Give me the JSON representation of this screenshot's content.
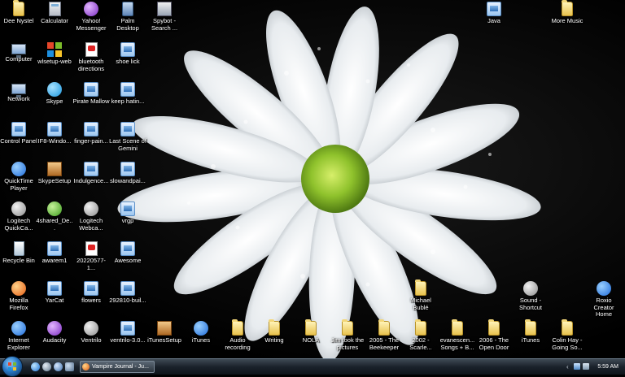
{
  "desktop": {
    "icons": [
      {
        "label": "Dee Nystel",
        "icon": "folder-icon"
      },
      {
        "label": "Calculator",
        "icon": "calculator-icon"
      },
      {
        "label": "Yahoo! Messenger",
        "icon": "yahoo-messenger-icon"
      },
      {
        "label": "Palm Desktop",
        "icon": "palm-desktop-icon"
      },
      {
        "label": "Spybot - Search ...",
        "icon": "spybot-icon"
      },
      {
        "label": "Java",
        "icon": "image-file-icon"
      },
      {
        "label": "More Music",
        "icon": "folder-icon"
      },
      {
        "label": "Computer",
        "icon": "computer-icon"
      },
      {
        "label": "wlsetup-web",
        "icon": "windows-live-icon"
      },
      {
        "label": "bluetooth directions",
        "icon": "pdf-icon"
      },
      {
        "label": "shoe lick",
        "icon": "image-file-icon"
      },
      {
        "label": "Network",
        "icon": "network-icon"
      },
      {
        "label": "Skype",
        "icon": "skype-icon"
      },
      {
        "label": "Pirate Mallow",
        "icon": "image-file-icon"
      },
      {
        "label": "keep hatin...",
        "icon": "image-file-icon"
      },
      {
        "label": "Control Panel",
        "icon": "control-panel-icon"
      },
      {
        "label": "IF8-Windo...",
        "icon": "image-file-icon"
      },
      {
        "label": "finger-pain...",
        "icon": "image-file-icon"
      },
      {
        "label": "Last Scene of Gemini",
        "icon": "image-file-icon"
      },
      {
        "label": "QuickTime Player",
        "icon": "quicktime-icon"
      },
      {
        "label": "SkypeSetup",
        "icon": "skype-setup-icon"
      },
      {
        "label": "Indulgence...",
        "icon": "image-file-icon"
      },
      {
        "label": "slowandpai...",
        "icon": "image-file-icon"
      },
      {
        "label": "Logitech QuickCa...",
        "icon": "logitech-icon"
      },
      {
        "label": "4shared_De...",
        "icon": "shared-desktop-icon"
      },
      {
        "label": "Logitech Webca...",
        "icon": "webcam-icon"
      },
      {
        "label": "vrgp",
        "icon": "image-file-icon"
      },
      {
        "label": "Recycle Bin",
        "icon": "recycle-bin-icon"
      },
      {
        "label": "awarem1",
        "icon": "image-file-icon"
      },
      {
        "label": "20220577-1...",
        "icon": "pdf-icon"
      },
      {
        "label": "Awesome",
        "icon": "image-file-icon"
      },
      {
        "label": "Mozilla Firefox",
        "icon": "firefox-icon"
      },
      {
        "label": "YarCat",
        "icon": "image-file-icon"
      },
      {
        "label": "flowers",
        "icon": "image-file-icon"
      },
      {
        "label": "292810-buil...",
        "icon": "image-file-icon"
      },
      {
        "label": "Michael Bublé",
        "icon": "folder-icon"
      },
      {
        "label": "Sound - Shortcut",
        "icon": "sound-shortcut-icon"
      },
      {
        "label": "Roxio Creator Home",
        "icon": "roxio-icon"
      },
      {
        "label": "Internet Explorer",
        "icon": "internet-explorer-icon"
      },
      {
        "label": "Audacity",
        "icon": "audacity-icon"
      },
      {
        "label": "Ventrilo",
        "icon": "ventrilo-icon"
      },
      {
        "label": "ventrilo-3.0...",
        "icon": "installer-icon"
      },
      {
        "label": "iTunesSetup",
        "icon": "installer-box-icon"
      },
      {
        "label": "iTunes",
        "icon": "itunes-icon"
      },
      {
        "label": "Audio recording",
        "icon": "folder-icon"
      },
      {
        "label": "Writing",
        "icon": "folder-icon"
      },
      {
        "label": "NOLA",
        "icon": "folder-icon"
      },
      {
        "label": "Jim took the pictures",
        "icon": "folder-icon"
      },
      {
        "label": "2005 - The Beekeeper",
        "icon": "folder-icon"
      },
      {
        "label": "2002 - Scarle...",
        "icon": "folder-icon"
      },
      {
        "label": "evanescen... Songs + B...",
        "icon": "folder-icon"
      },
      {
        "label": "2006 - The Open Door",
        "icon": "folder-icon"
      },
      {
        "label": "iTunes",
        "icon": "folder-icon"
      },
      {
        "label": "Colin Hay - Going So...",
        "icon": "folder-icon"
      }
    ]
  },
  "taskbar": {
    "task_firefox": "Vampire Journal - Ju...",
    "clock": "5:59 AM",
    "chevron": "‹"
  }
}
